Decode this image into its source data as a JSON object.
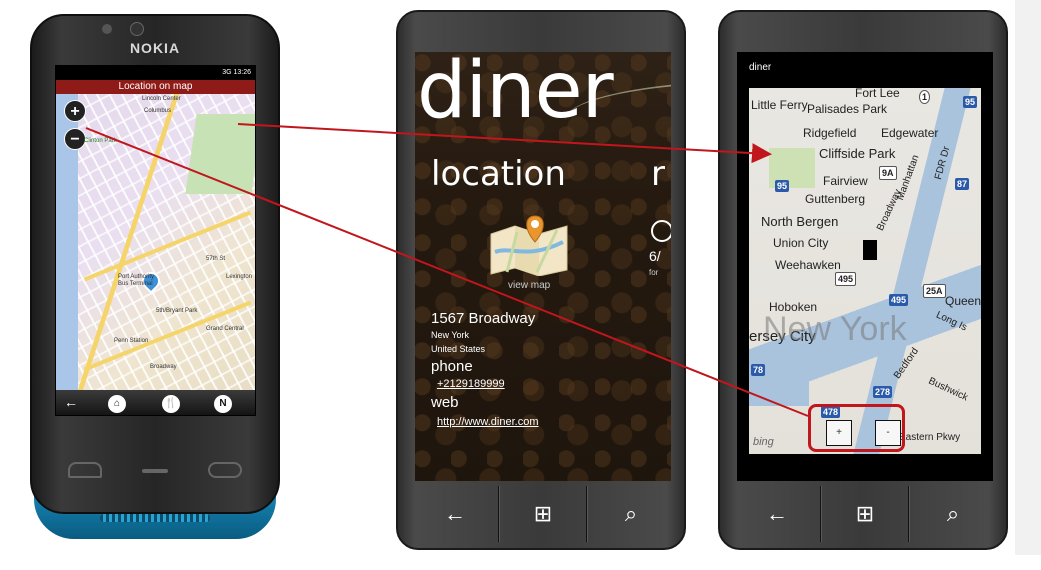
{
  "nokia": {
    "brand": "NOKIA",
    "status_bar": "3G 13:26",
    "title": "Location on map",
    "zoom_in": "+",
    "zoom_out": "−",
    "map_labels": [
      "Lincoln Center",
      "Columbus",
      "Clinton Park",
      "Port Authority Bus Terminal",
      "Penn Station",
      "Madison Sq Garden",
      "Grand Central",
      "57th St",
      "42nd St",
      "34th St",
      "5th/Bryant Park",
      "Lexington",
      "Broadway"
    ],
    "toolbar": {
      "back": "←",
      "home": "⌂",
      "restaurant": "🍴",
      "compass": "N"
    }
  },
  "wp1": {
    "app_title": "diner",
    "pivot_current": "location",
    "pivot_next": "r",
    "view_map": "view map",
    "address_line": "1567 Broadway",
    "city": "New York",
    "country": "United States",
    "phone_label": "phone",
    "phone_value": "+2129189999",
    "web_label": "web",
    "web_value": "http://www.diner.com",
    "peek_value": "6/",
    "peek_sub": "for"
  },
  "wp2": {
    "title": "diner",
    "labels": {
      "fort_lee": "Fort Lee",
      "little_ferry": "Little Ferry",
      "palisades_park": "Palisades Park",
      "ridgefield": "Ridgefield",
      "edgewater": "Edgewater",
      "cliffside_park": "Cliffside Park",
      "fairview": "Fairview",
      "guttenberg": "Guttenberg",
      "north_bergen": "North Bergen",
      "union_city": "Union City",
      "weehawken": "Weehawken",
      "hoboken": "Hoboken",
      "jersey_city": "ersey City",
      "new_york": "New York",
      "queens": "Queen",
      "manhattan": "Manhattan",
      "broadway": "Broadway",
      "eastern_pkwy": "Eastern Pkwy",
      "bushwick": "Bushwick",
      "bedford": "Bedford",
      "fdr": "FDR Dr",
      "long_is": "Long Is"
    },
    "shields": {
      "s1": "1",
      "s95": "95",
      "s9a": "9A",
      "s87": "87",
      "s495": "495",
      "s495b": "495",
      "s25a": "25A",
      "s78": "78",
      "s278": "278",
      "s478": "478"
    },
    "zoom_in": "+",
    "zoom_out": "-",
    "bing": "bing"
  },
  "hardware": {
    "back": "←",
    "windows": "⊞",
    "search": "⌕"
  },
  "colors": {
    "arrow": "#c0161c",
    "nokia_title_bar": "#8e1b17",
    "nokia_base": "#1d8bb8"
  }
}
